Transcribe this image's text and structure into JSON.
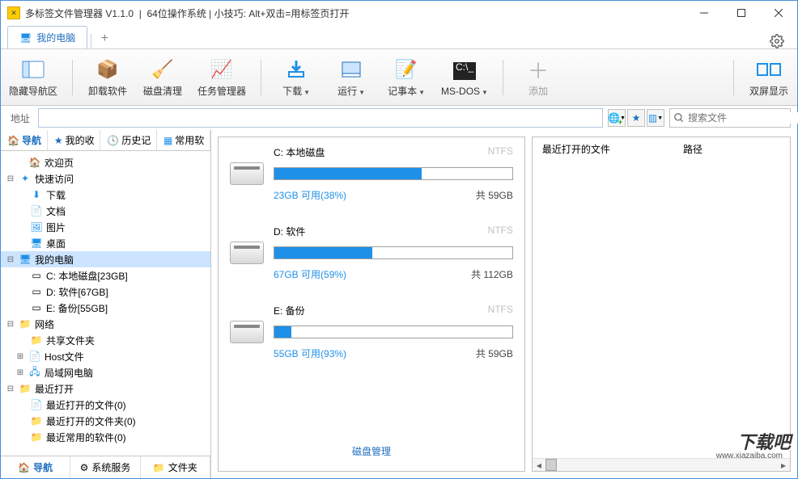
{
  "titlebar": {
    "app_name": "多标签文件管理器 V1.1.0",
    "sys_info": "64位操作系统",
    "tip": "小技巧: Alt+双击=用标签页打开"
  },
  "tabs": {
    "main_tab": "我的电脑",
    "plus": "+"
  },
  "toolbar": {
    "hide_nav": "隐藏导航区",
    "uninstall": "卸载软件",
    "disk_clean": "磁盘清理",
    "task_mgr": "任务管理器",
    "download": "下载",
    "run": "运行",
    "notepad": "记事本",
    "msdos": "MS-DOS",
    "add": "添加",
    "dual_screen": "双屏显示"
  },
  "addressbar": {
    "label": "地址",
    "search_placeholder": "搜索文件"
  },
  "side_tabs": {
    "nav": "导航",
    "fav": "我的收",
    "history": "历史记",
    "common": "常用软"
  },
  "tree": {
    "welcome": "欢迎页",
    "quick": "快速访问",
    "download": "下载",
    "docs": "文档",
    "pics": "图片",
    "desktop": "桌面",
    "mypc": "我的电脑",
    "drive_c": "C: 本地磁盘[23GB]",
    "drive_d": "D: 软件[67GB]",
    "drive_e": "E: 备份[55GB]",
    "network": "网络",
    "share": "共享文件夹",
    "host": "Host文件",
    "lan": "局域网电脑",
    "recent": "最近打开",
    "recent_files": "最近打开的文件(0)",
    "recent_folders": "最近打开的文件夹(0)",
    "recent_soft": "最近常用的软件(0)"
  },
  "bottom_tabs": {
    "nav": "导航",
    "services": "系统服务",
    "folders": "文件夹"
  },
  "disks": {
    "c": {
      "name": "C: 本地磁盘",
      "fs": "NTFS",
      "avail": "23GB 可用(38%)",
      "total": "共 59GB",
      "fillpct": 62
    },
    "d": {
      "name": "D: 软件",
      "fs": "NTFS",
      "avail": "67GB 可用(59%)",
      "total": "共 112GB",
      "fillpct": 41
    },
    "e": {
      "name": "E: 备份",
      "fs": "NTFS",
      "avail": "55GB 可用(93%)",
      "total": "共 59GB",
      "fillpct": 7
    },
    "manage": "磁盘管理"
  },
  "recent_panel": {
    "col_file": "最近打开的文件",
    "col_path": "路径"
  },
  "watermark": {
    "main": "下载吧",
    "sub": "www.xiazaiba.com"
  }
}
